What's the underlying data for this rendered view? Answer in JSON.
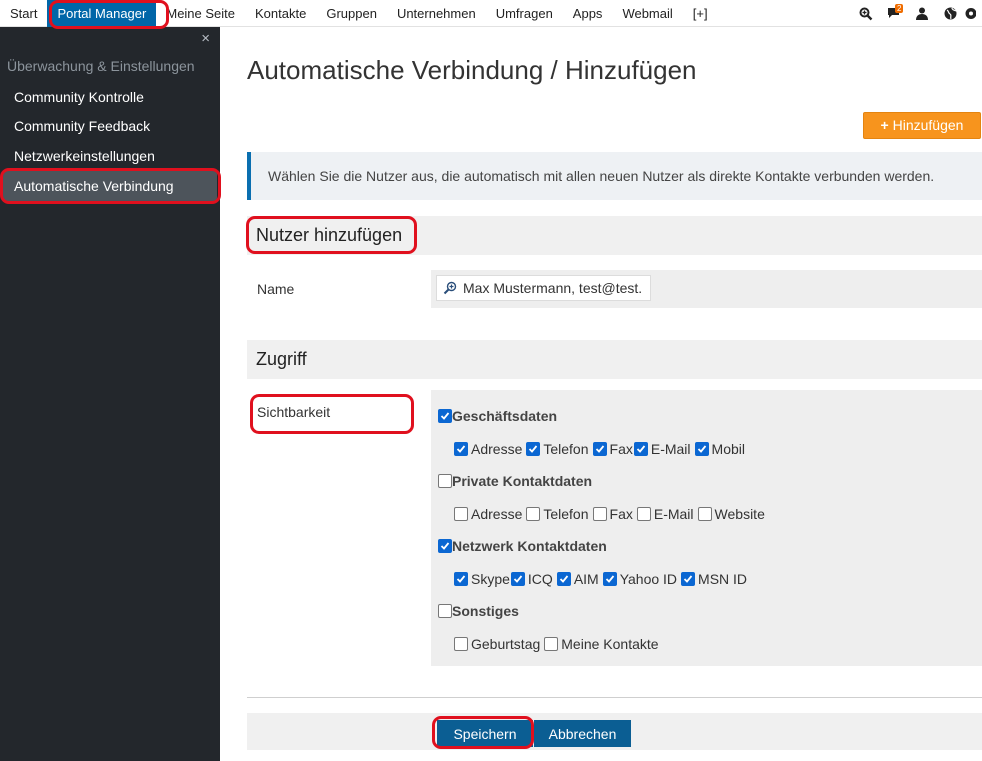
{
  "topnav": {
    "items": [
      "Start",
      "Portal Manager",
      "Meine Seite",
      "Kontakte",
      "Gruppen",
      "Unternehmen",
      "Umfragen",
      "Apps",
      "Webmail",
      "[+]"
    ],
    "active_index": 1,
    "icons": [
      "search-icon",
      "chat-icon",
      "user-icon",
      "globe-icon",
      "settings-icon"
    ],
    "chat_badge": "2"
  },
  "sidebar": {
    "close_label": "×",
    "section_label": "Überwachung & Einstellungen",
    "items": [
      "Community Kontrolle",
      "Community Feedback",
      "Netzwerkeinstellungen",
      "Automatische Verbindung"
    ],
    "active_index": 3
  },
  "main": {
    "title": "Automatische Verbindung / Hinzufügen",
    "add_button": "Hinzufügen",
    "info_text": "Wählen Sie die Nutzer aus, die automatisch mit allen neuen Nutzer als direkte Kontakte verbunden werden.",
    "section_users": "Nutzer hinzufügen",
    "name_label": "Name",
    "name_value": "Max Mustermann, test@test.",
    "section_access": "Zugriff",
    "visibility_label": "Sichtbarkeit",
    "groups": [
      {
        "label": "Geschäftsdaten",
        "checked": true,
        "options": [
          {
            "label": "Adresse",
            "checked": true
          },
          {
            "label": "Telefon",
            "checked": true
          },
          {
            "label": "Fax",
            "checked": true
          },
          {
            "label": "E-Mail",
            "checked": true
          },
          {
            "label": "Mobil",
            "checked": true
          }
        ]
      },
      {
        "label": "Private Kontaktdaten",
        "checked": false,
        "options": [
          {
            "label": "Adresse",
            "checked": false
          },
          {
            "label": "Telefon",
            "checked": false
          },
          {
            "label": "Fax",
            "checked": false
          },
          {
            "label": "E-Mail",
            "checked": false
          },
          {
            "label": "Website",
            "checked": false
          }
        ]
      },
      {
        "label": "Netzwerk Kontaktdaten",
        "checked": true,
        "options": [
          {
            "label": "Skype",
            "checked": true
          },
          {
            "label": "ICQ",
            "checked": true
          },
          {
            "label": "AIM",
            "checked": true
          },
          {
            "label": "Yahoo ID",
            "checked": true
          },
          {
            "label": "MSN ID",
            "checked": true
          }
        ]
      },
      {
        "label": "Sonstiges",
        "checked": false,
        "options": [
          {
            "label": "Geburtstag",
            "checked": false
          },
          {
            "label": "Meine Kontakte",
            "checked": false
          }
        ]
      }
    ],
    "save_button": "Speichern",
    "cancel_button": "Abbrechen"
  },
  "colors": {
    "nav_active": "#0066a8",
    "sidebar_bg": "#23272c",
    "accent_orange": "#f7941d",
    "primary_button": "#0b5e93",
    "checkbox_checked": "#0b67d2",
    "highlight_red": "#e0101e"
  }
}
